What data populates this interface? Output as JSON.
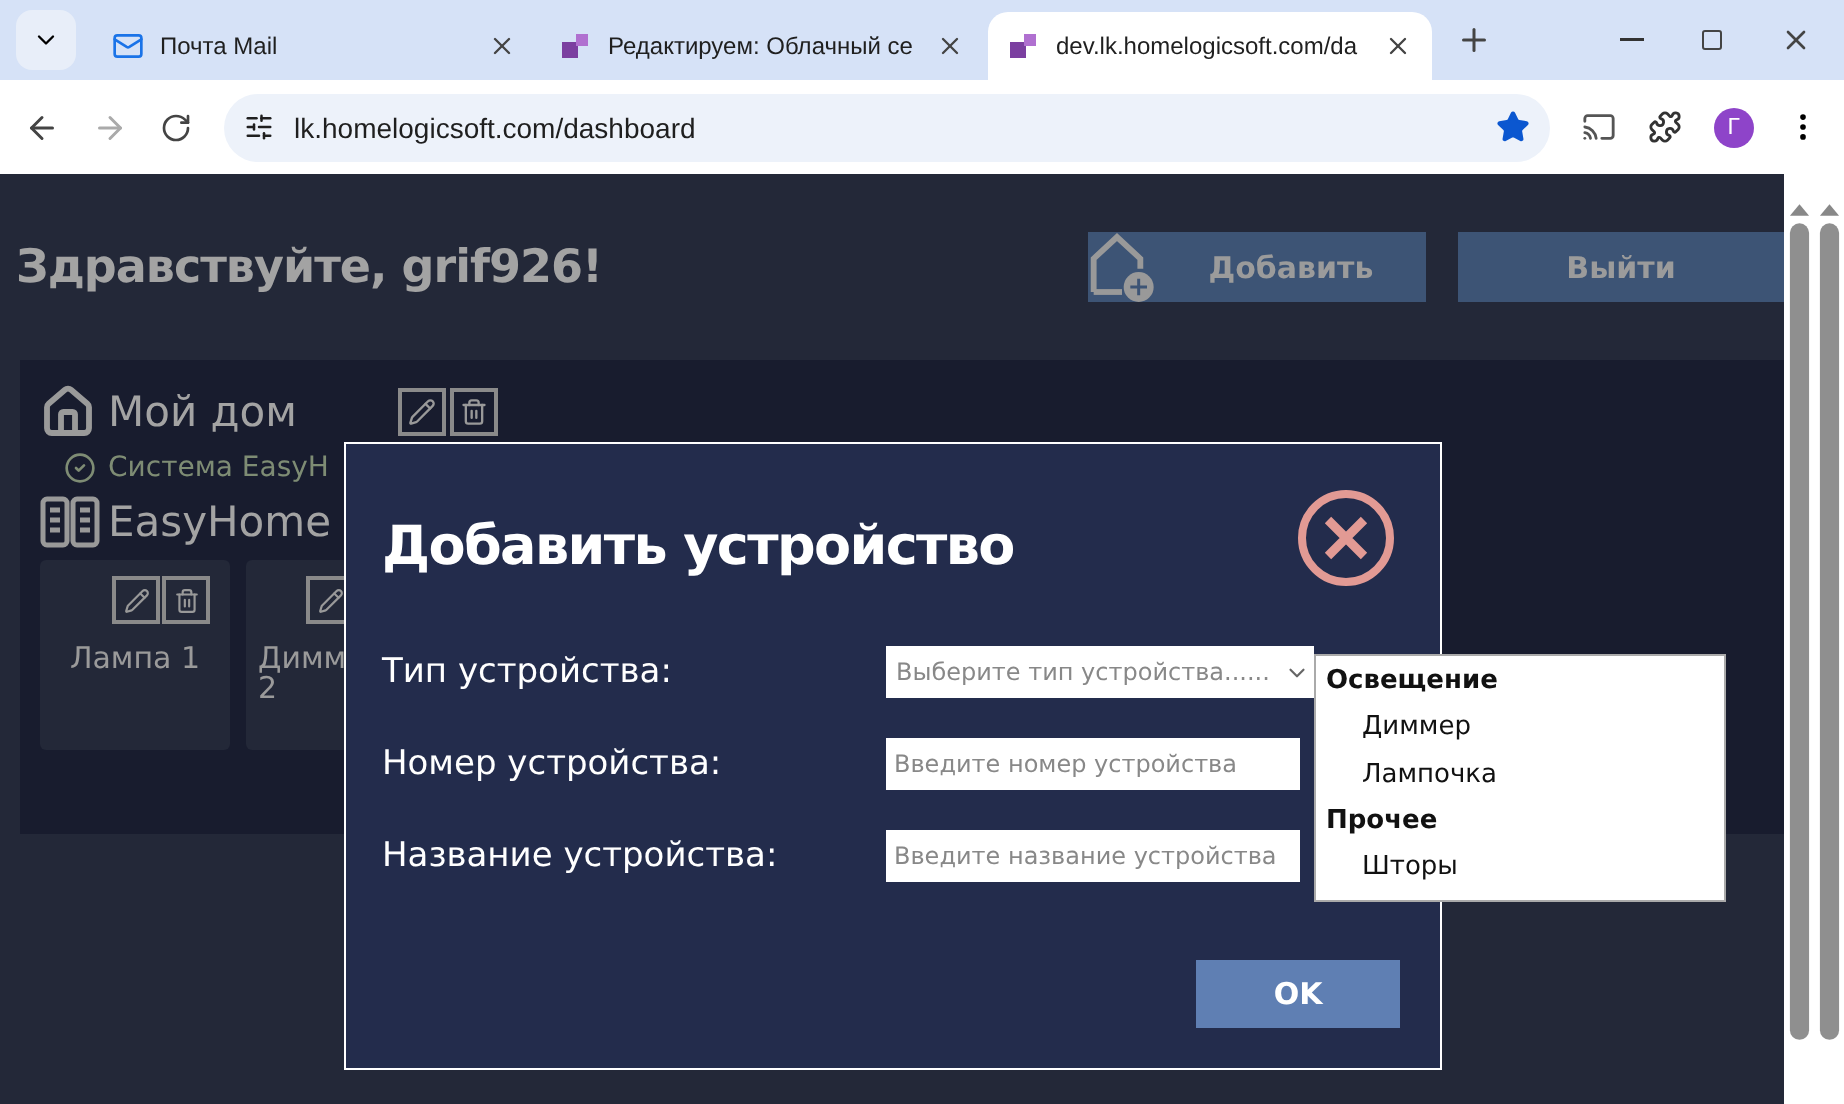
{
  "browser": {
    "tabs": [
      {
        "title": "Почта Mail",
        "selected": false
      },
      {
        "title": "Редактируем: Облачный се",
        "selected": false
      },
      {
        "title": "dev.lk.homelogicsoft.com/da",
        "selected": true
      }
    ],
    "address": "lk.homelogicsoft.com/dashboard",
    "bookmarked": true,
    "avatar": "Г"
  },
  "page": {
    "greeting": "Здравствуйте, grif926!",
    "buttons": [
      {
        "label": "Добавить",
        "kind": "add"
      },
      {
        "label": "Выйти",
        "kind": "plain"
      }
    ],
    "home": {
      "title": "Мой дом",
      "status": "Система EasyH",
      "hub": {
        "name": "EasyHome",
        "devices": [
          {
            "name": "Лампа 1"
          },
          {
            "name": "Димм 2"
          }
        ]
      }
    }
  },
  "dialog": {
    "title": "Добавить устройство",
    "fields": [
      {
        "label": "Тип устройства:",
        "kind": "select",
        "placeholder": "Выберите тип устройства......"
      },
      {
        "label": "Номер устройства:",
        "kind": "text",
        "placeholder": "Введите номер устройства"
      },
      {
        "label": "Название устройства:",
        "kind": "text",
        "placeholder": "Введите название устройства"
      }
    ],
    "ok": "OK",
    "dropdown": [
      {
        "group": "Освещение",
        "options": [
          "Диммер",
          "Лампочка"
        ]
      },
      {
        "group": "Прочее",
        "options": [
          "Шторы"
        ]
      }
    ]
  }
}
